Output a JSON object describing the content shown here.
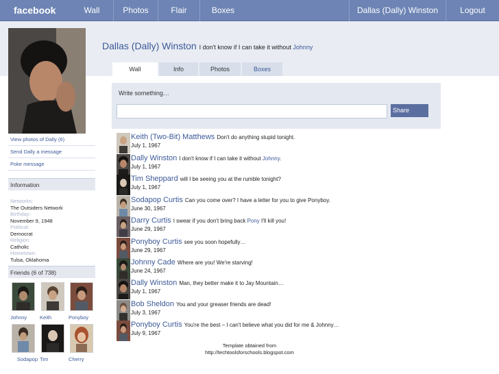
{
  "topbar": {
    "logo": "facebook",
    "nav": [
      "Wall",
      "Photos",
      "Flair",
      "Boxes"
    ],
    "user_name": "Dallas (Dally) Winston",
    "logout": "Logout"
  },
  "profile": {
    "name": "Dallas (Dally) Winston",
    "status_prefix": "I don't know if I can take it without",
    "status_link": "Johnny"
  },
  "left_links": [
    "View photos of Dally (6)",
    "Send Dally a message",
    "Poke message"
  ],
  "information": {
    "heading": "Information",
    "fields": [
      {
        "label": "Networks:",
        "value": "The Outsiders Network"
      },
      {
        "label": "Birthday:",
        "value": "November 9, 1948"
      },
      {
        "label": "Political:",
        "value": "Democrat"
      },
      {
        "label": "Religion:",
        "value": "Catholic"
      },
      {
        "label": "Hometown:",
        "value": "Tulsa, Oklahoma"
      }
    ]
  },
  "friends": {
    "heading": "Friends (6 of 738)",
    "names": [
      "Johnny",
      "Keith",
      "Ponyboy",
      "Sodapop",
      "Tim",
      "Cherry"
    ]
  },
  "tabs": [
    "Wall",
    "Info",
    "Photos",
    "Boxes"
  ],
  "composer": {
    "label": "Write something…",
    "share": "Share"
  },
  "posts": [
    {
      "author": "Keith (Two-Bit) Matthews",
      "message": "Don't do anything stupid tonight.",
      "date": "July 1, 1967"
    },
    {
      "author": "Dally Winston",
      "message": "I don't know if I can take it without",
      "link": "Johnny",
      "suffix": ".",
      "date": "July 1, 1967"
    },
    {
      "author": "Tim Sheppard",
      "message": "will I be seeing you at the rumble tonight?",
      "date": "July 1, 1967"
    },
    {
      "author": "Sodapop Curtis",
      "message": "Can you come over? I have a letter for you to give Ponyboy.",
      "date": "June 30, 1967"
    },
    {
      "author": "Darry Curtis",
      "message": "I swear if you don't bring back",
      "link": "Pony",
      "suffix": " I'll kill you!",
      "date": "June 29, 1967"
    },
    {
      "author": "Ponyboy Curtis",
      "message": "see you soon hopefully…",
      "date": "June 29, 1967"
    },
    {
      "author": "Johnny Cade",
      "message": "Where are you! We're starving!",
      "date": "June 24, 1967"
    },
    {
      "author": "Dally Winston",
      "message": "Man, they better make it to Jay Mountain…",
      "date": "July 1, 1967"
    },
    {
      "author": "Bob Sheldon",
      "message": "You and your greaser friends are dead!",
      "date": "July 3, 1967"
    },
    {
      "author": "Ponyboy Curtis",
      "message": "You're the best – I can't believe what you did for me & Johnny…",
      "date": "July 9, 1967"
    }
  ],
  "footer": {
    "line1": "Template obtained from",
    "line2": "http://techtoolsforschools.blogspot.com"
  },
  "colors": {
    "brand": "#6d84b4",
    "link": "#3b5998",
    "share_button": "#5b6ea0"
  }
}
